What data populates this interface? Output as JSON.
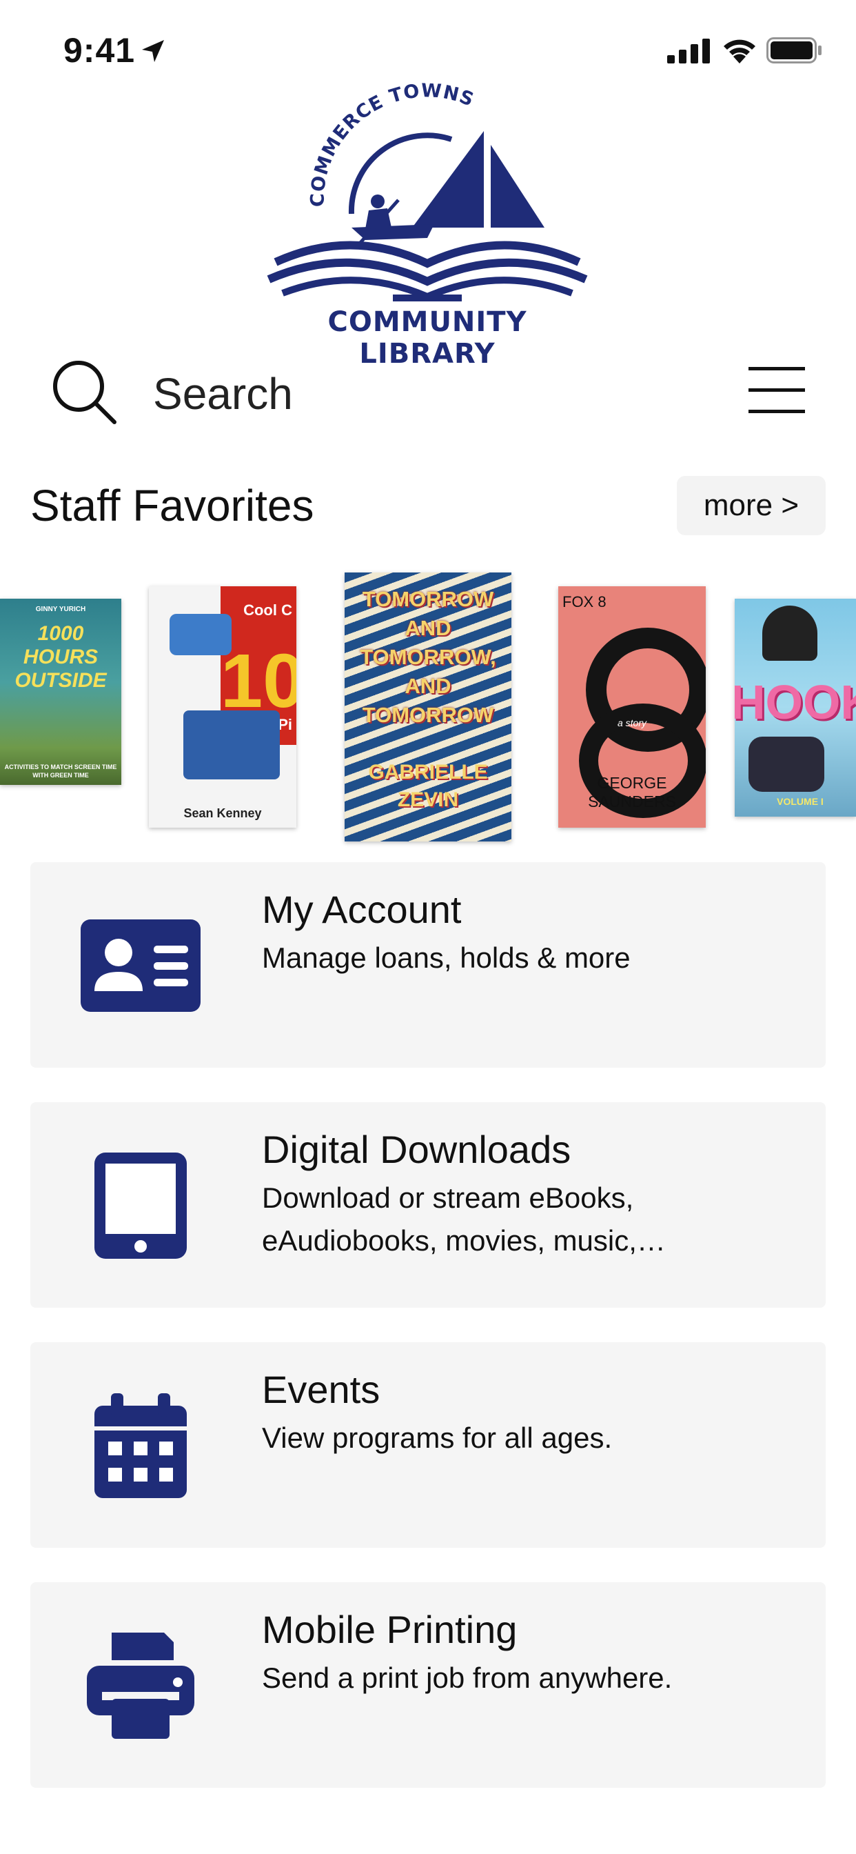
{
  "status_bar": {
    "time": "9:41"
  },
  "brand": {
    "arc_text": "COMMERCE TOWNSHIP",
    "name": "COMMUNITY LIBRARY",
    "color": "#1f2c78"
  },
  "search": {
    "placeholder": "Search"
  },
  "staff_favorites": {
    "title": "Staff Favorites",
    "more_label": "more >",
    "books": [
      {
        "author": "GINNY YURICH",
        "title": "1000 HOURS OUTSIDE",
        "subtitle": "ACTIVITIES TO MATCH SCREEN TIME WITH GREEN TIME"
      },
      {
        "author": "Sean Kenney",
        "title": "Cool C",
        "number": "10",
        "suffix": "Pi"
      },
      {
        "title": "TOMORROW AND TOMORROW, AND TOMORROW",
        "author": "GABRIELLE ZEVIN"
      },
      {
        "title": "FOX 8",
        "author": "GEORGE SAUNDERS",
        "subtitle": "a story"
      },
      {
        "title": "HOOKY",
        "subtitle": "VOLUME I"
      }
    ]
  },
  "menu_cards": [
    {
      "title": "My Account",
      "description": "Manage loans, holds & more",
      "icon": "id-card-icon"
    },
    {
      "title": "Digital Downloads",
      "description": "Download or stream eBooks, eAudiobooks, movies, music,…",
      "icon": "tablet-icon"
    },
    {
      "title": "Events",
      "description": "View programs for all ages.",
      "icon": "calendar-icon"
    },
    {
      "title": "Mobile Printing",
      "description": "Send a print job from anywhere.",
      "icon": "printer-icon"
    }
  ]
}
